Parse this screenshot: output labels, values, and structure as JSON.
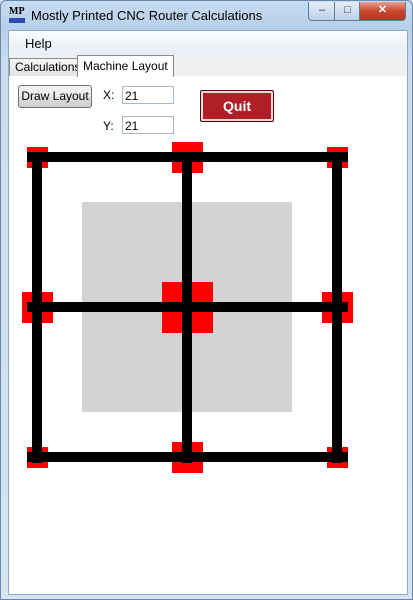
{
  "window": {
    "title": "Mostly Printed CNC Router Calculations",
    "icon_text": "MP",
    "controls": {
      "minimize": "–",
      "maximize": "□",
      "close": "✕"
    }
  },
  "menu": {
    "help": "Help"
  },
  "tabs": [
    {
      "label": "Calculations",
      "active": false
    },
    {
      "label": "Machine Layout",
      "active": true
    }
  ],
  "layout_panel": {
    "draw_button": "Draw Layout",
    "x_label": "X:",
    "x_value": "21",
    "y_label": "Y:",
    "y_value": "21",
    "quit_button": "Quit"
  },
  "colors": {
    "work_area": "#d3d3d3",
    "rail": "#000000",
    "corner_block": "#ff0000",
    "quit": "#b01f26"
  }
}
